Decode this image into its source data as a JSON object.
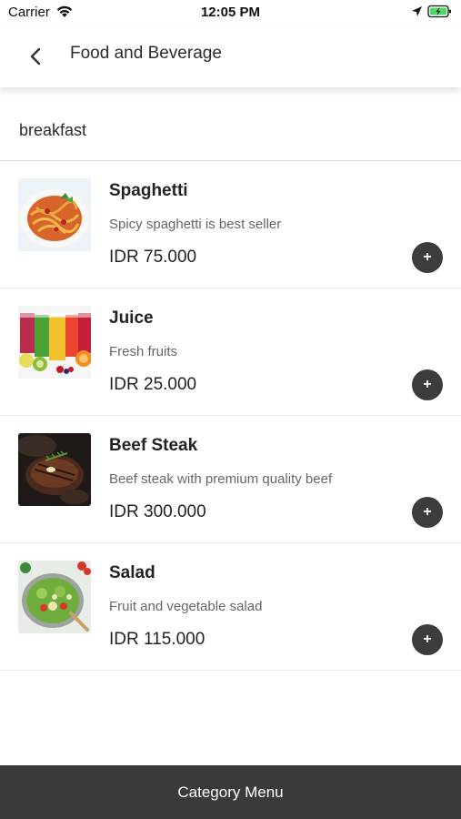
{
  "status_bar": {
    "carrier": "Carrier",
    "time": "12:05 PM",
    "icons": [
      "wifi-icon",
      "location-arrow-icon",
      "battery-charging-icon"
    ]
  },
  "header": {
    "back_icon": "chevron-left-icon",
    "title": "Food and Beverage"
  },
  "category": {
    "label": "breakfast"
  },
  "menu_items": [
    {
      "name": "Spaghetti",
      "description": "Spicy spaghetti is best seller",
      "price": "IDR 75.000",
      "image": "spaghetti-image",
      "add_label": "+"
    },
    {
      "name": "Juice",
      "description": "Fresh fruits",
      "price": "IDR 25.000",
      "image": "juice-image",
      "add_label": "+"
    },
    {
      "name": "Beef Steak",
      "description": "Beef steak with premium quality beef",
      "price": "IDR 300.000",
      "image": "beef-steak-image",
      "add_label": "+"
    },
    {
      "name": "Salad",
      "description": "Fruit and vegetable salad",
      "price": "IDR 115.000",
      "image": "salad-image",
      "add_label": "+"
    }
  ],
  "bottom_bar": {
    "label": "Category Menu"
  },
  "colors": {
    "add_button": "#3c3c3c",
    "bottom_bar": "#3a3a3a",
    "battery_fill": "#4cd964"
  }
}
